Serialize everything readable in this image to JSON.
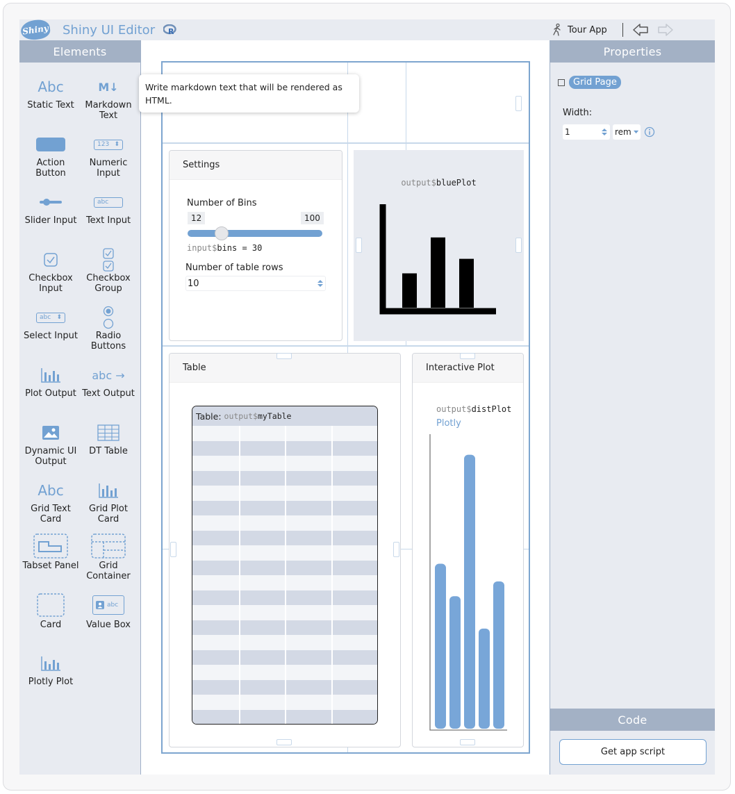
{
  "header": {
    "logo_text": "Shiny",
    "app_title": "Shiny UI Editor",
    "tour_label": "Tour App",
    "accent": "#72a1d2",
    "icons": [
      "r-logo-icon",
      "walking-person-icon",
      "undo-arrow-icon",
      "redo-arrow-icon"
    ]
  },
  "elements_panel": {
    "title": "Elements",
    "items": [
      {
        "label": "Static Text",
        "icon_text": "Abc"
      },
      {
        "label": "Markdown Text",
        "icon_text": "M↓"
      },
      {
        "label": "Action Button"
      },
      {
        "label": "Numeric Input",
        "icon_text": "123"
      },
      {
        "label": "Slider Input"
      },
      {
        "label": "Text Input",
        "icon_text": "abc"
      },
      {
        "label": "Checkbox Input"
      },
      {
        "label": "Checkbox Group"
      },
      {
        "label": "Select Input",
        "icon_text": "abc"
      },
      {
        "label": "Radio Buttons"
      },
      {
        "label": "Plot Output"
      },
      {
        "label": "Text Output",
        "icon_text": "abc"
      },
      {
        "label": "Dynamic UI Output"
      },
      {
        "label": "DT Table"
      },
      {
        "label": "Grid Text Card",
        "icon_text": "Abc"
      },
      {
        "label": "Grid Plot Card"
      },
      {
        "label": "Tabset Panel"
      },
      {
        "label": "Grid Container"
      },
      {
        "label": "Card"
      },
      {
        "label": "Value Box",
        "icon_text": "abc"
      },
      {
        "label": "Plotly Plot"
      }
    ]
  },
  "tooltip": {
    "text": "Write markdown text that will be rendered as HTML."
  },
  "canvas": {
    "settings_card": {
      "title": "Settings",
      "slider": {
        "label": "Number of Bins",
        "min": "12",
        "max": "100",
        "value_fraction": 0.2,
        "output_prefix": "input$",
        "output_text": "bins = 30"
      },
      "numeric": {
        "label": "Number of table rows",
        "value": "10"
      }
    },
    "blue_plot": {
      "prefix": "output$",
      "name": "bluePlot",
      "bars": [
        0.45,
        0.92,
        0.64
      ]
    },
    "table_card": {
      "title": "Table",
      "table_label": "Table:",
      "prefix": "output$",
      "name": "myTable",
      "rows": 20,
      "cols": 4
    },
    "interactive_card": {
      "title": "Interactive Plot",
      "prefix": "output$",
      "name": "distPlot",
      "engine": "Plotly",
      "bars": [
        0.56,
        0.45,
        0.93,
        0.34,
        0.5
      ]
    }
  },
  "properties": {
    "title": "Properties",
    "node_label": "Grid Page",
    "width_label": "Width:",
    "width_value": "1",
    "unit": "rem"
  },
  "code": {
    "title": "Code",
    "button_label": "Get app script"
  }
}
